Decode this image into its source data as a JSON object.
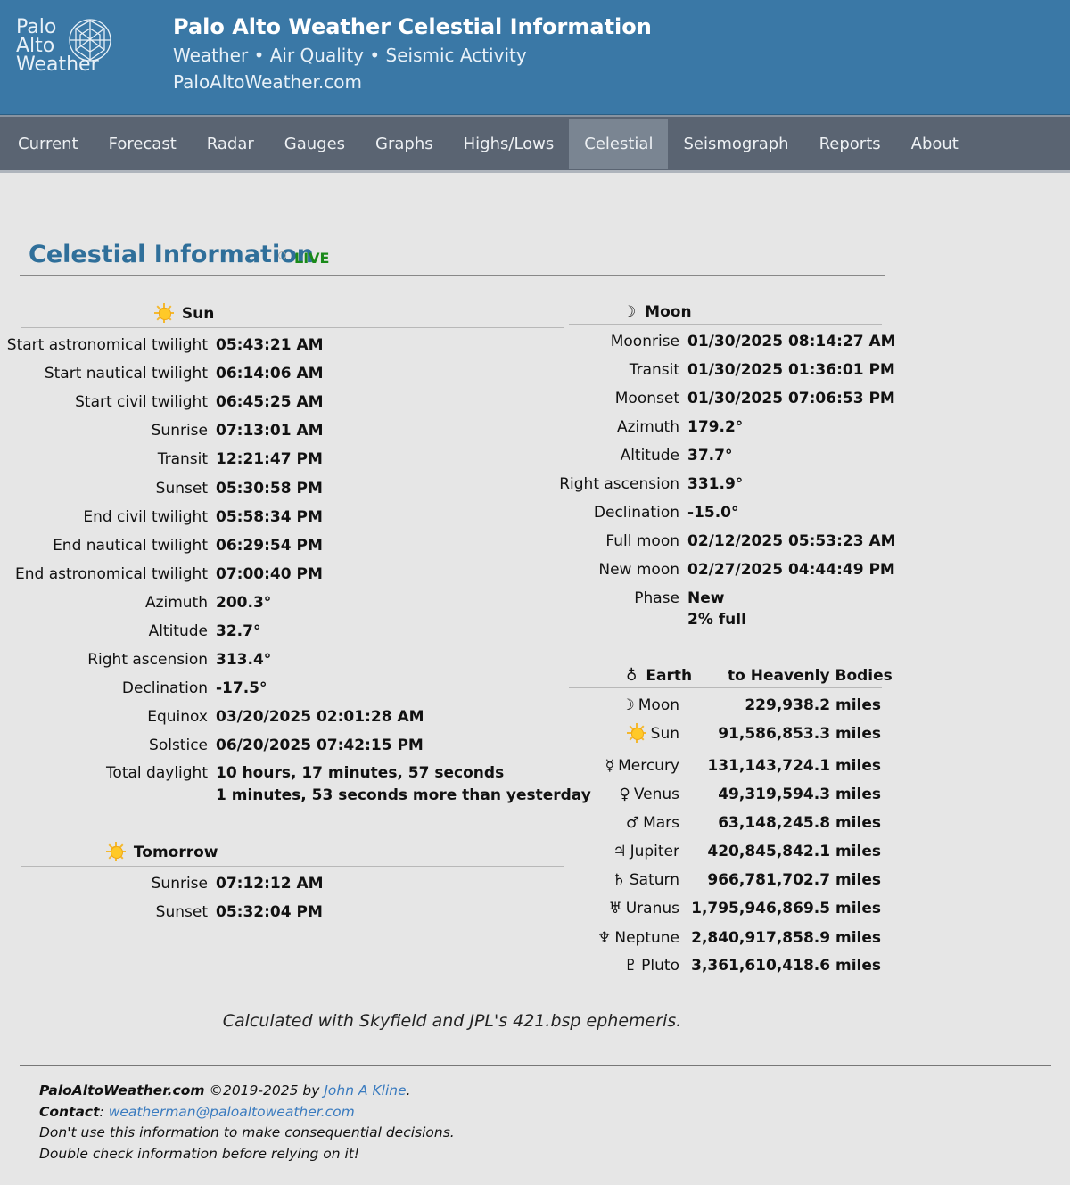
{
  "header": {
    "logo_lines": [
      "Palo",
      "Alto",
      "Weather"
    ],
    "title": "Palo Alto Weather Celestial Information",
    "subtitle": "Weather • Air Quality • Seismic Activity",
    "url": "PaloAltoWeather.com"
  },
  "nav": {
    "items": [
      {
        "label": "Current"
      },
      {
        "label": "Forecast"
      },
      {
        "label": "Radar"
      },
      {
        "label": "Gauges"
      },
      {
        "label": "Graphs"
      },
      {
        "label": "Highs/Lows"
      },
      {
        "label": "Celestial",
        "active": true
      },
      {
        "label": "Seismograph"
      },
      {
        "label": "Reports"
      },
      {
        "label": "About"
      }
    ]
  },
  "section": {
    "title": "Celestial Information",
    "live": "LIVE"
  },
  "sun": {
    "heading": "Sun",
    "rows": [
      {
        "label": "Start astronomical twilight",
        "value": "05:43:21 AM"
      },
      {
        "label": "Start nautical twilight",
        "value": "06:14:06 AM"
      },
      {
        "label": "Start civil twilight",
        "value": "06:45:25 AM"
      },
      {
        "label": "Sunrise",
        "value": "07:13:01 AM"
      },
      {
        "label": "Transit",
        "value": "12:21:47 PM"
      },
      {
        "label": "Sunset",
        "value": "05:30:58 PM"
      },
      {
        "label": "End civil twilight",
        "value": "05:58:34 PM"
      },
      {
        "label": "End nautical twilight",
        "value": "06:29:54 PM"
      },
      {
        "label": "End astronomical twilight",
        "value": "07:00:40 PM"
      },
      {
        "label": "Azimuth",
        "value": "200.3°"
      },
      {
        "label": "Altitude",
        "value": "32.7°"
      },
      {
        "label": "Right ascension",
        "value": "313.4°"
      },
      {
        "label": "Declination",
        "value": "-17.5°"
      },
      {
        "label": "Equinox",
        "value": "03/20/2025 02:01:28 AM"
      },
      {
        "label": "Solstice",
        "value": "06/20/2025 07:42:15 PM"
      }
    ],
    "daylight_label": "Total daylight",
    "daylight_value": "10 hours, 17 minutes, 57 seconds",
    "daylight_delta": "1 minutes, 53 seconds more than yesterday"
  },
  "tomorrow": {
    "heading": "Tomorrow",
    "rows": [
      {
        "label": "Sunrise",
        "value": "07:12:12 AM"
      },
      {
        "label": "Sunset",
        "value": "05:32:04 PM"
      }
    ]
  },
  "moon": {
    "heading": "Moon",
    "heading_symbol": "☽",
    "rows": [
      {
        "label": "Moonrise",
        "value": "01/30/2025 08:14:27 AM"
      },
      {
        "label": "Transit",
        "value": "01/30/2025 01:36:01 PM"
      },
      {
        "label": "Moonset",
        "value": "01/30/2025 07:06:53 PM"
      },
      {
        "label": "Azimuth",
        "value": "179.2°"
      },
      {
        "label": "Altitude",
        "value": "37.7°"
      },
      {
        "label": "Right ascension",
        "value": "331.9°"
      },
      {
        "label": "Declination",
        "value": "-15.0°"
      },
      {
        "label": "Full moon",
        "value": "02/12/2025 05:53:23 AM"
      },
      {
        "label": "New moon",
        "value": "02/27/2025 04:44:49 PM"
      }
    ],
    "phase_label": "Phase",
    "phase_value": "New",
    "phase_full": "2% full"
  },
  "earth": {
    "heading": "Earth",
    "heading_symbol": "♁",
    "heading_right": "to Heavenly Bodies",
    "rows": [
      {
        "symbol": "☽",
        "label": "Moon",
        "value": "229,938.2 miles"
      },
      {
        "symbol": "sun",
        "label": "Sun",
        "value": "91,586,853.3 miles"
      },
      {
        "symbol": "☿",
        "label": "Mercury",
        "value": "131,143,724.1 miles"
      },
      {
        "symbol": "♀",
        "label": "Venus",
        "value": "49,319,594.3 miles"
      },
      {
        "symbol": "♂",
        "label": "Mars",
        "value": "63,148,245.8 miles"
      },
      {
        "symbol": "♃",
        "label": "Jupiter",
        "value": "420,845,842.1 miles"
      },
      {
        "symbol": "♄",
        "label": "Saturn",
        "value": "966,781,702.7 miles"
      },
      {
        "symbol": "♅",
        "label": "Uranus",
        "value": "1,795,946,869.5 miles"
      },
      {
        "symbol": "♆",
        "label": "Neptune",
        "value": "2,840,917,858.9 miles"
      },
      {
        "symbol": "♇",
        "label": "Pluto",
        "value": "3,361,610,418.6 miles"
      }
    ]
  },
  "footnote": "Calculated with Skyfield and JPL's 421.bsp ephemeris.",
  "footer": {
    "site": "PaloAltoWeather.com",
    "copyright": "©2019-2025 by",
    "author": "John A Kline",
    "contact_label": "Contact",
    "email": "weatherman@paloaltoweather.com",
    "disclaimer1": "Don't use this information to make consequential decisions.",
    "disclaimer2": "Double check information before relying on it!"
  }
}
